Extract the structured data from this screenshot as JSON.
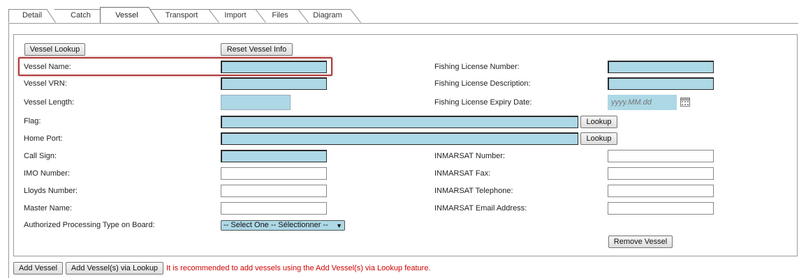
{
  "tabs": [
    {
      "label": "Detail",
      "active": false
    },
    {
      "label": "Catch",
      "active": false
    },
    {
      "label": "Vessel",
      "active": true
    },
    {
      "label": "Transport",
      "active": false
    },
    {
      "label": "Import",
      "active": false
    },
    {
      "label": "Files",
      "active": false
    },
    {
      "label": "Diagram",
      "active": false
    }
  ],
  "buttons": {
    "vessel_lookup": "Vessel Lookup",
    "reset_vessel_info": "Reset Vessel Info",
    "flag_lookup": "Lookup",
    "home_port_lookup": "Lookup",
    "remove_vessel": "Remove Vessel",
    "add_vessel": "Add Vessel",
    "add_vessels_via_lookup": "Add Vessel(s) via Lookup"
  },
  "labels": {
    "vessel_name": "Vessel Name:",
    "vessel_vrn": "Vessel VRN:",
    "vessel_length": "Vessel Length:",
    "flag": "Flag:",
    "home_port": "Home Port:",
    "call_sign": "Call Sign:",
    "imo_number": "IMO Number:",
    "lloyds_number": "Lloyds Number:",
    "master_name": "Master Name:",
    "authorized_processing": "Authorized Processing Type on Board:",
    "fishing_license_number": "Fishing License Number:",
    "fishing_license_description": "Fishing License Description:",
    "fishing_license_expiry": "Fishing License Expiry Date:",
    "inmarsat_number": "INMARSAT Number:",
    "inmarsat_fax": "INMARSAT Fax:",
    "inmarsat_telephone": "INMARSAT Telephone:",
    "inmarsat_email": "INMARSAT Email Address:"
  },
  "fields": {
    "vessel_name": "",
    "vessel_vrn": "",
    "vessel_length": "",
    "flag": "",
    "home_port": "",
    "call_sign": "",
    "imo_number": "",
    "lloyds_number": "",
    "master_name": "",
    "fishing_license_number": "",
    "fishing_license_description": "",
    "fishing_license_expiry_placeholder": "yyyy.MM.dd",
    "inmarsat_number": "",
    "inmarsat_fax": "",
    "inmarsat_telephone": "",
    "inmarsat_email": ""
  },
  "select": {
    "processing_type_selected": "-- Select One -- Sélectionner --"
  },
  "icons": {
    "calendar": "calendar-icon",
    "dropdown": "chevron-down-icon"
  },
  "colors": {
    "required_field": "#add8e6",
    "highlight": "#b03a3a",
    "note": "#d00000"
  },
  "footer_note": "It is recommended to add vessels using the Add Vessel(s) via Lookup feature."
}
